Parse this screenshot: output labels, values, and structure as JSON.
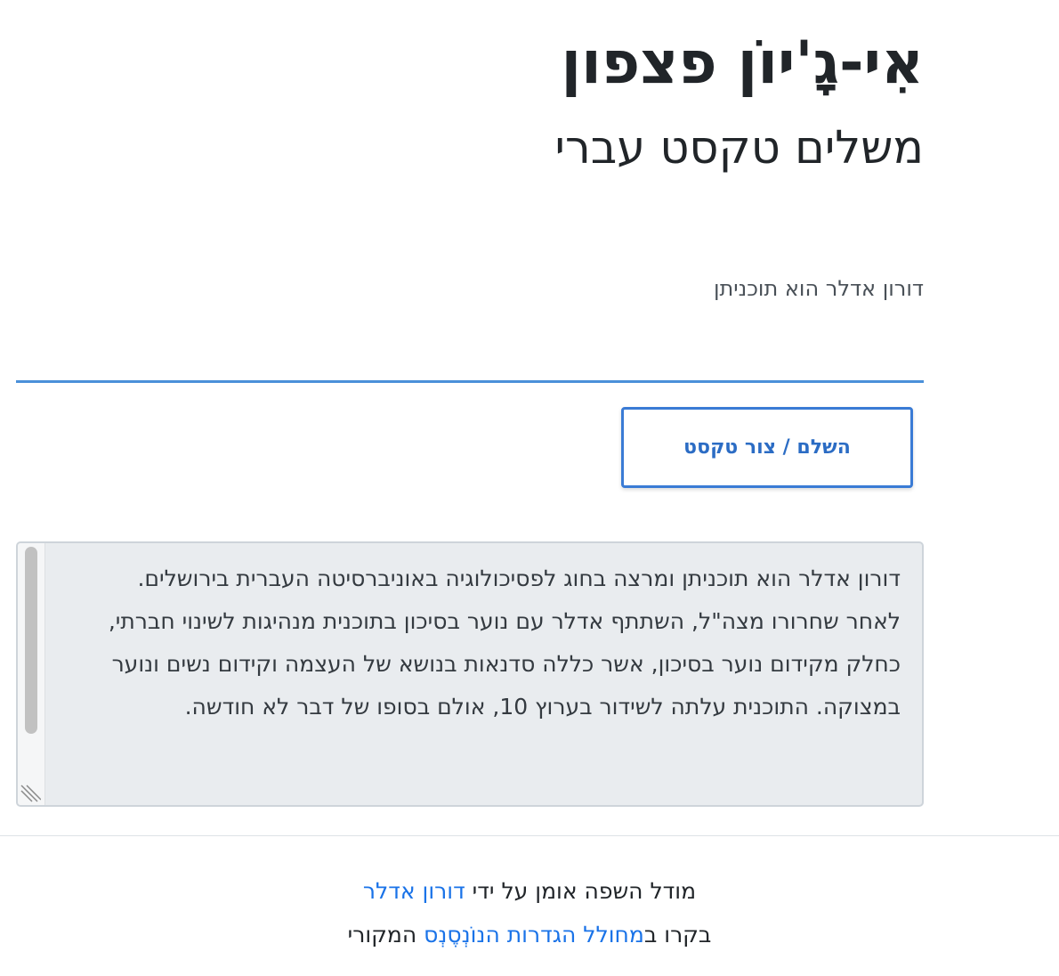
{
  "header": {
    "title": "אִי-גָ'יוֹן פצפון",
    "subtitle": "משלים טקסט עברי"
  },
  "prompt": {
    "value": "דורון אדלר הוא תוכניתן"
  },
  "actions": {
    "complete_label": "השלם / צור טקסט"
  },
  "output": {
    "text": "דורון אדלר הוא תוכניתן ומרצה בחוג לפסיכולוגיה באוניברסיטה העברית בירושלים.\nלאחר שחרורו מצה\"ל, השתתף אדלר עם נוער בסיכון בתוכנית מנהיגות לשינוי חברתי, כחלק מקידום נוער בסיכון, אשר כללה סדנאות בנושא של העצמה וקידום נשים ונוער במצוקה. התוכנית עלתה לשידור בערוץ 10, אולם בסופו של דבר לא חודשה."
  },
  "footer": {
    "line1_prefix": "מודל השפה אומן על ידי",
    "line1_link": "דורון אדלר",
    "line2_prefix": "בקרו ב",
    "line2_link": "מחולל הגדרות הנוֹנְסֶנְס",
    "line2_suffix": "המקורי"
  },
  "colors": {
    "accent": "#3a7bd5",
    "link": "#1a73e8",
    "output_background": "#e9ecef"
  }
}
